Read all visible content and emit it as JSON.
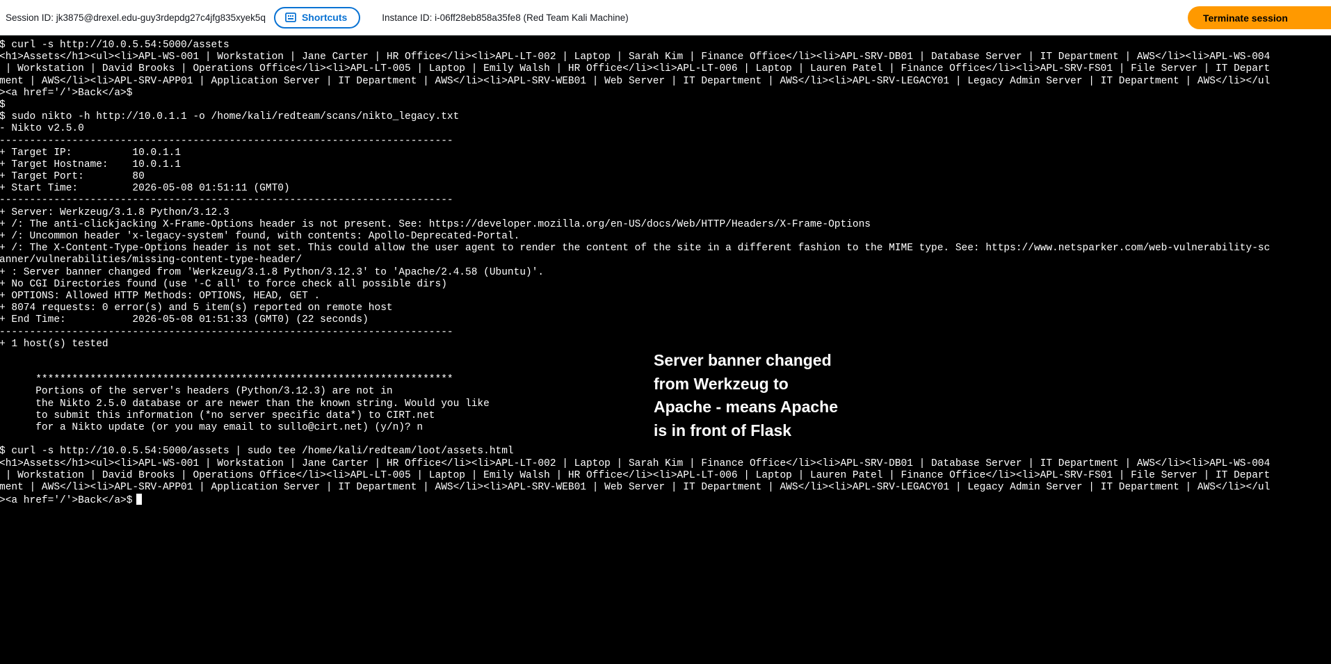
{
  "header": {
    "session_id": "Session ID: jk3875@drexel.edu-guy3rdepdg27c4jfg835xyek5q",
    "shortcuts_label": "Shortcuts",
    "shortcuts_icon": "keyboard-icon",
    "instance_id": "Instance ID: i-06ff28eb858a35fe8 (Red Team Kali Machine)",
    "terminate_label": "Terminate session",
    "accent_color": "#0972d3",
    "terminate_color": "#ff9900"
  },
  "terminal": {
    "lines": [
      "$ curl -s http://10.0.5.54:5000/assets",
      "<h1>Assets</h1><ul><li>APL-WS-001 | Workstation | Jane Carter | HR Office</li><li>APL-LT-002 | Laptop | Sarah Kim | Finance Office</li><li>APL-SRV-DB01 | Database Server | IT Department | AWS</li><li>APL-WS-004",
      " | Workstation | David Brooks | Operations Office</li><li>APL-LT-005 | Laptop | Emily Walsh | HR Office</li><li>APL-LT-006 | Laptop | Lauren Patel | Finance Office</li><li>APL-SRV-FS01 | File Server | IT Depart",
      "ment | AWS</li><li>APL-SRV-APP01 | Application Server | IT Department | AWS</li><li>APL-SRV-WEB01 | Web Server | IT Department | AWS</li><li>APL-SRV-LEGACY01 | Legacy Admin Server | IT Department | AWS</li></ul",
      "><a href='/'>Back</a>$",
      "$",
      "$ sudo nikto -h http://10.0.1.1 -o /home/kali/redteam/scans/nikto_legacy.txt",
      "- Nikto v2.5.0",
      "---------------------------------------------------------------------------",
      "+ Target IP:          10.0.1.1",
      "+ Target Hostname:    10.0.1.1",
      "+ Target Port:        80",
      "+ Start Time:         2026-05-08 01:51:11 (GMT0)",
      "---------------------------------------------------------------------------",
      "+ Server: Werkzeug/3.1.8 Python/3.12.3",
      "+ /: The anti-clickjacking X-Frame-Options header is not present. See: https://developer.mozilla.org/en-US/docs/Web/HTTP/Headers/X-Frame-Options",
      "+ /: Uncommon header 'x-legacy-system' found, with contents: Apollo-Deprecated-Portal.",
      "+ /: The X-Content-Type-Options header is not set. This could allow the user agent to render the content of the site in a different fashion to the MIME type. See: https://www.netsparker.com/web-vulnerability-sc",
      "anner/vulnerabilities/missing-content-type-header/",
      "+ : Server banner changed from 'Werkzeug/3.1.8 Python/3.12.3' to 'Apache/2.4.58 (Ubuntu)'.",
      "+ No CGI Directories found (use '-C all' to force check all possible dirs)",
      "+ OPTIONS: Allowed HTTP Methods: OPTIONS, HEAD, GET .",
      "+ 8074 requests: 0 error(s) and 5 item(s) reported on remote host",
      "+ End Time:           2026-05-08 01:51:33 (GMT0) (22 seconds)",
      "---------------------------------------------------------------------------",
      "+ 1 host(s) tested",
      "",
      "",
      "      *********************************************************************",
      "      Portions of the server's headers (Python/3.12.3) are not in",
      "      the Nikto 2.5.0 database or are newer than the known string. Would you like",
      "      to submit this information (*no server specific data*) to CIRT.net",
      "      for a Nikto update (or you may email to sullo@cirt.net) (y/n)? n",
      "",
      "$ curl -s http://10.0.5.54:5000/assets | sudo tee /home/kali/redteam/loot/assets.html",
      "<h1>Assets</h1><ul><li>APL-WS-001 | Workstation | Jane Carter | HR Office</li><li>APL-LT-002 | Laptop | Sarah Kim | Finance Office</li><li>APL-SRV-DB01 | Database Server | IT Department | AWS</li><li>APL-WS-004",
      " | Workstation | David Brooks | Operations Office</li><li>APL-LT-005 | Laptop | Emily Walsh | HR Office</li><li>APL-LT-006 | Laptop | Lauren Patel | Finance Office</li><li>APL-SRV-FS01 | File Server | IT Depart",
      "ment | AWS</li><li>APL-SRV-APP01 | Application Server | IT Department | AWS</li><li>APL-SRV-WEB01 | Web Server | IT Department | AWS</li><li>APL-SRV-LEGACY01 | Legacy Admin Server | IT Department | AWS</li></ul"
    ],
    "last_line": "><a href='/'>Back</a>$"
  },
  "annotation": {
    "lines": [
      "Server banner changed",
      "from Werkzeug to",
      "Apache - means Apache",
      "is in front of Flask"
    ]
  }
}
